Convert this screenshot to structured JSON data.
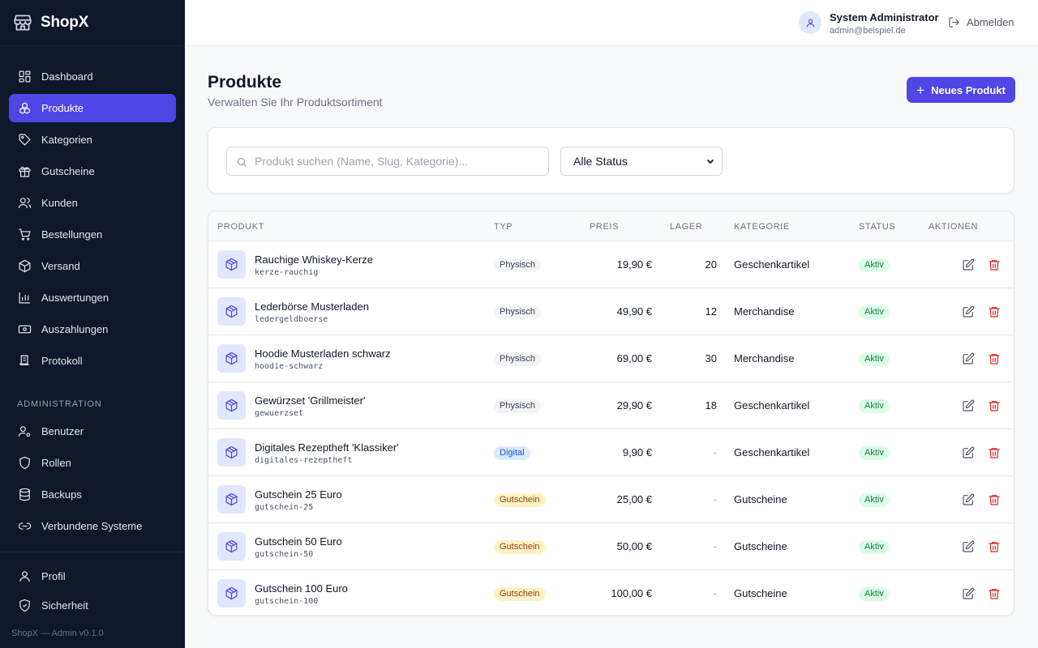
{
  "brand": {
    "name": "ShopX"
  },
  "sidebar": {
    "items": [
      {
        "label": "Dashboard",
        "icon": "dashboard-icon"
      },
      {
        "label": "Produkte",
        "icon": "products-icon",
        "active": true
      },
      {
        "label": "Kategorien",
        "icon": "tag-icon"
      },
      {
        "label": "Gutscheine",
        "icon": "gift-icon"
      },
      {
        "label": "Kunden",
        "icon": "users-icon"
      },
      {
        "label": "Bestellungen",
        "icon": "cart-icon"
      },
      {
        "label": "Versand",
        "icon": "package-icon"
      },
      {
        "label": "Auswertungen",
        "icon": "chart-icon"
      },
      {
        "label": "Auszahlungen",
        "icon": "banknote-icon"
      },
      {
        "label": "Protokoll",
        "icon": "log-icon"
      }
    ],
    "admin_label": "ADMINISTRATION",
    "admin_items": [
      {
        "label": "Benutzer",
        "icon": "user-cog-icon"
      },
      {
        "label": "Rollen",
        "icon": "shield-icon"
      },
      {
        "label": "Backups",
        "icon": "database-icon"
      },
      {
        "label": "Verbundene Systeme",
        "icon": "link-icon"
      }
    ],
    "bottom_items": [
      {
        "label": "Profil",
        "icon": "user-icon"
      },
      {
        "label": "Sicherheit",
        "icon": "shield-check-icon"
      }
    ],
    "version": "ShopX — Admin v0.1.0"
  },
  "header": {
    "user_name": "System Administrator",
    "user_email": "admin@beispiel.de",
    "logout_label": "Abmelden"
  },
  "page": {
    "title": "Produkte",
    "subtitle": "Verwalten Sie Ihr Produktsortiment",
    "new_button": "Neues Produkt"
  },
  "filters": {
    "search_placeholder": "Produkt suchen (Name, Slug, Kategorie)...",
    "search_value": "",
    "status_selected": "Alle Status"
  },
  "table": {
    "headers": {
      "product": "PRODUKT",
      "type": "TYP",
      "price": "PREIS",
      "stock": "LAGER",
      "category": "KATEGORIE",
      "status": "STATUS",
      "actions": "AKTIONEN"
    },
    "rows": [
      {
        "name": "Rauchige Whiskey-Kerze",
        "slug": "kerze-rauchig",
        "type": "Physisch",
        "type_kind": "physisch",
        "price": "19,90 €",
        "stock": "20",
        "category": "Geschenkartikel",
        "status": "Aktiv"
      },
      {
        "name": "Lederbörse Musterladen",
        "slug": "ledergeldboerse",
        "type": "Physisch",
        "type_kind": "physisch",
        "price": "49,90 €",
        "stock": "12",
        "category": "Merchandise",
        "status": "Aktiv"
      },
      {
        "name": "Hoodie Musterladen schwarz",
        "slug": "hoodie-schwarz",
        "type": "Physisch",
        "type_kind": "physisch",
        "price": "69,00 €",
        "stock": "30",
        "category": "Merchandise",
        "status": "Aktiv"
      },
      {
        "name": "Gewürzset 'Grillmeister'",
        "slug": "gewuerzset",
        "type": "Physisch",
        "type_kind": "physisch",
        "price": "29,90 €",
        "stock": "18",
        "category": "Geschenkartikel",
        "status": "Aktiv"
      },
      {
        "name": "Digitales Rezeptheft 'Klassiker'",
        "slug": "digitales-rezeptheft",
        "type": "Digital",
        "type_kind": "digital",
        "price": "9,90 €",
        "stock": "-",
        "category": "Geschenkartikel",
        "status": "Aktiv"
      },
      {
        "name": "Gutschein 25 Euro",
        "slug": "gutschein-25",
        "type": "Gutschein",
        "type_kind": "gutschein",
        "price": "25,00 €",
        "stock": "-",
        "category": "Gutscheine",
        "status": "Aktiv"
      },
      {
        "name": "Gutschein 50 Euro",
        "slug": "gutschein-50",
        "type": "Gutschein",
        "type_kind": "gutschein",
        "price": "50,00 €",
        "stock": "-",
        "category": "Gutscheine",
        "status": "Aktiv"
      },
      {
        "name": "Gutschein 100 Euro",
        "slug": "gutschein-100",
        "type": "Gutschein",
        "type_kind": "gutschein",
        "price": "100,00 €",
        "stock": "-",
        "category": "Gutscheine",
        "status": "Aktiv"
      }
    ]
  },
  "colors": {
    "accent": "#4f46e5",
    "sidebar_bg": "#0f172a",
    "danger": "#dc2626",
    "success": "#15803d"
  }
}
